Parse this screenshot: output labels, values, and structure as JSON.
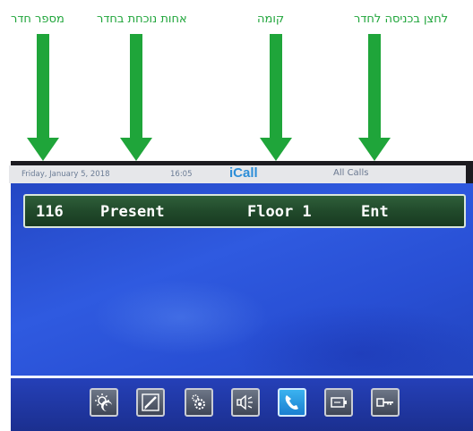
{
  "annotations": {
    "room_number": "מספר חדר",
    "nurse_present": "אחות נוכחת בחדר",
    "floor": "קומה",
    "enter_button": "לחצן בכניסה לחדר"
  },
  "status_bar": {
    "date": "Friday, January 5, 2018",
    "time": "16:05",
    "brand": "iCall",
    "mode": "All Calls"
  },
  "call_row": {
    "room": "116",
    "status": "Present",
    "floor": "Floor 1",
    "action": "Ent"
  },
  "toolbar": {
    "buttons": [
      {
        "icon": "night-mode-icon"
      },
      {
        "icon": "pen-icon"
      },
      {
        "icon": "settings-icon"
      },
      {
        "icon": "speaker-icon"
      },
      {
        "icon": "phone-icon",
        "active": true
      },
      {
        "icon": "card-icon"
      },
      {
        "icon": "key-icon"
      }
    ]
  },
  "colors": {
    "annotation_green": "#1fa53a",
    "screen_blue": "#2f5ae0",
    "call_row_green": "#214a2b",
    "active_button": "#2a9ae6"
  }
}
